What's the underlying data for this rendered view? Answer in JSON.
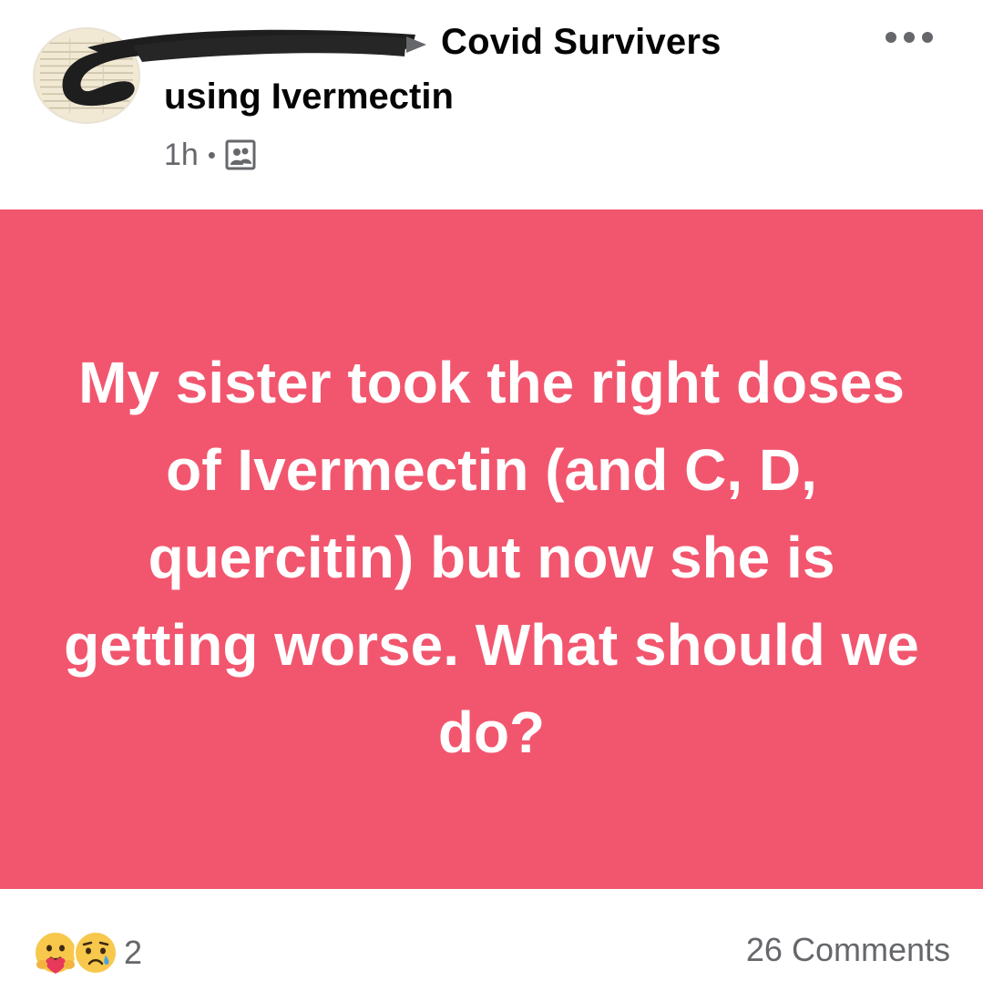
{
  "header": {
    "author_name": "",
    "group_name_line1": "Covid Survivers",
    "group_name_line2": "using Ivermectin",
    "timestamp": "1h",
    "separator": "•",
    "audience_icon": "group-audience-icon",
    "more_icon": "more-options-icon"
  },
  "post": {
    "text": "My sister took the right doses of Ivermectin (and C, D, quercitin) but now she is getting worse. What should we do?",
    "background_color": "#f2566e",
    "text_color": "#ffffff"
  },
  "footer": {
    "reaction_icons": [
      "care-reaction-icon",
      "sad-reaction-icon"
    ],
    "reaction_count": "2",
    "comments": "26 Comments"
  },
  "colors": {
    "secondary_text": "#65676b",
    "primary_text": "#050505"
  }
}
